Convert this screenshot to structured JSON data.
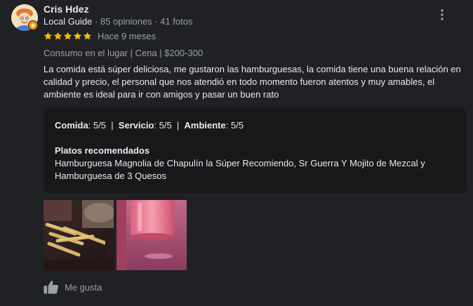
{
  "reviewer": {
    "name": "Cris Hdez",
    "guide_label": "Local Guide",
    "stats": " · 85 opiniones · 41 fotos"
  },
  "rating": {
    "stars": 5,
    "time": "Hace 9 meses"
  },
  "meta": "Consumo en el lugar  |  Cena  |  $200-300",
  "review_text": "La comida está súper deliciosa, me gustaron las hamburguesas, la comida tiene una buena relación en calidad y precio,  el personal que nos atendió en todo momento fueron atentos y muy amables, el ambiente es ideal para ir con amigos y pasar un buen rato",
  "ratings_card": {
    "food_label": "Comida",
    "food_value": ": 5/5",
    "sep1": "  |  ",
    "service_label": "Servicio",
    "service_value": ": 5/5",
    "sep2": "  |  ",
    "ambience_label": "Ambiente",
    "ambience_value": ": 5/5",
    "dishes_title": "Platos recomendados",
    "dishes_text": "Hamburguesa Magnolia de Chapulín la Súper Recomiendo, Sr Guerra Y Mojito de Mezcal y Hamburguesa de 3 Quesos"
  },
  "actions": {
    "like_label": "Me gusta"
  },
  "colors": {
    "background": "#202124",
    "card": "#17181a",
    "star": "#fbbc04",
    "text": "#e8eaed",
    "muted": "#9aa0a6"
  },
  "icons": [
    "more-vert-icon",
    "star-icon",
    "thumb-up-icon",
    "local-guide-badge-icon"
  ]
}
